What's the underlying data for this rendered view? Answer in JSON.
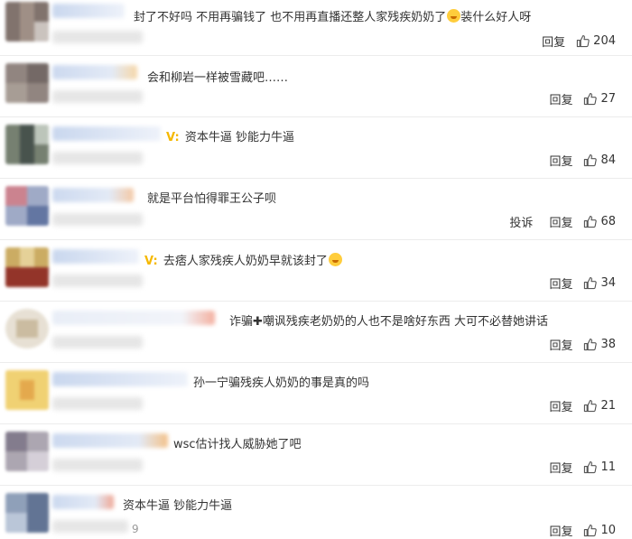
{
  "labels": {
    "reply": "回复",
    "report": "投诉"
  },
  "comments": [
    {
      "text": "封了不好吗 不用再骗钱了 也不用再直播还整人家残疾奶奶了",
      "text_after": "装什么好人呀",
      "likes": "204",
      "has_report": false
    },
    {
      "text": "会和柳岩一样被雪藏吧……",
      "likes": "27",
      "has_report": false
    },
    {
      "text": "资本牛逼 钞能力牛逼",
      "likes": "84",
      "has_report": false,
      "vip": "V:"
    },
    {
      "text": "就是平台怕得罪王公子呗",
      "likes": "68",
      "has_report": true
    },
    {
      "text": "去痞人家残疾人奶奶早就该封了",
      "likes": "34",
      "has_report": false,
      "vip": "V:"
    },
    {
      "text": "诈骗",
      "text_after": "嘲讽残疾老奶奶的人也不是啥好东西 大可不必替她讲话",
      "likes": "38",
      "has_report": false
    },
    {
      "text": "孙一宁骗残疾人奶奶的事是真的吗",
      "likes": "21",
      "has_report": false
    },
    {
      "text": "wsc估计找人威胁她了吧",
      "likes": "11",
      "has_report": false
    },
    {
      "text": "资本牛逼 钞能力牛逼",
      "likes": "10",
      "has_report": false,
      "partial_time": "9"
    }
  ],
  "colors": {
    "vip": "#f5b800",
    "divider": "#ececec"
  },
  "icons": {
    "like": "thumbs-up-icon",
    "emoji": "grin-emoji-icon",
    "plus": "heavy-plus-icon"
  }
}
